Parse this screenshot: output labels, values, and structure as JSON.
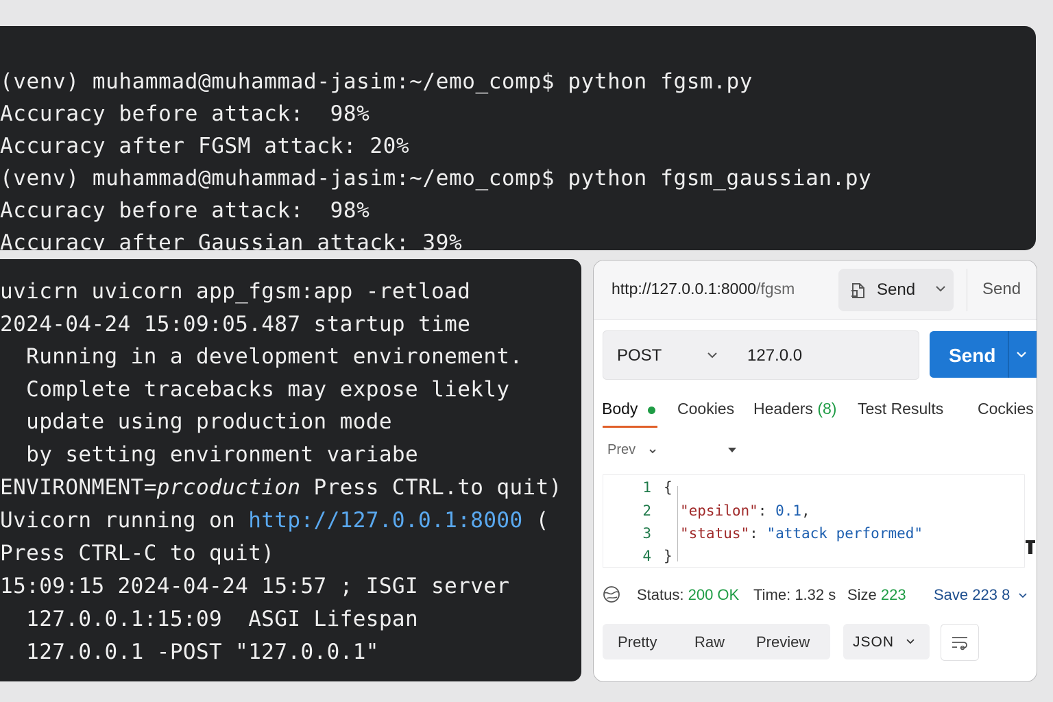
{
  "terminal_top": {
    "lines": [
      "(venv) muhammad@muhammad-jasim:~/emo_comp$ python fgsm.py",
      "Accuracy before attack:  98%",
      "Accuracy after FGSM attack: 20%",
      "(venv) muhammad@muhammad-jasim:~/emo_comp$ python fgsm_gaussian.py",
      "Accuracy before attack:  98%",
      "Accuracy after Gaussian attack: 39%"
    ]
  },
  "terminal_bottom": {
    "l0": "uvicrn uvicorn app_fgsm:app -retload",
    "l1": "2024-04-24 15:09:05.487 startup time",
    "l2": "  Running in a development environement.",
    "l3": "  Complete tracebacks may expose liekly",
    "l4": "  update using production mode",
    "l5": "  by setting environment variabe",
    "l6_a": "ENVIRONMENT=",
    "l6_b": "prcoduction",
    "l6_c": " Press CTRL.to quit)",
    "l7_a": "Uvicorn running on ",
    "l7_link": "http://127.0.0.1:8000",
    "l7_b": " (",
    "l8": "Press CTRL-C to quit)",
    "l9": "15:09:15 2024-04-24 15:57 ; ISGI server",
    "l10": "  127.0.0.1:15:09  ASGI Lifespan",
    "l11": "  127.0.0.1 -POST \"127.0.0.1\""
  },
  "api_panel": {
    "header_url_main": "http://127.0.0.1:8000",
    "header_url_path": "/fgsm",
    "header_send": "Send",
    "header_send_secondary": "Send",
    "method": "POST",
    "url_value": "127.0.0",
    "send_button": "Send",
    "tabs": {
      "body": "Body",
      "cookies": "Cookies",
      "headers": "Headers",
      "headers_count": "(8)",
      "test_results": "Test Results",
      "cookies2": "Cockies"
    },
    "preview_select": "Prev",
    "code": {
      "line_numbers": [
        "1",
        "2",
        "3",
        "4"
      ],
      "open_brace": "{",
      "close_brace": "}",
      "key1": "\"epsilon\"",
      "val1": "0.1",
      "key2": "\"status\"",
      "val2": "\"attack performed\""
    },
    "status": {
      "status_label": "Status:",
      "status_value": "200 OK",
      "time_label": "Time:",
      "time_value": "1.32 s",
      "size_label": "Size",
      "size_value": "223",
      "save_label": "Save 223 8"
    },
    "view_tabs": [
      "Pretty",
      "Raw",
      "Preview"
    ],
    "format": "JSON"
  },
  "colors": {
    "terminal_bg": "#222325",
    "terminal_text": "#eeeeee",
    "link": "#5aa9f0",
    "send_button": "#1e78d4",
    "success": "#1f9c45",
    "active_tab_underline": "#e0602a"
  }
}
